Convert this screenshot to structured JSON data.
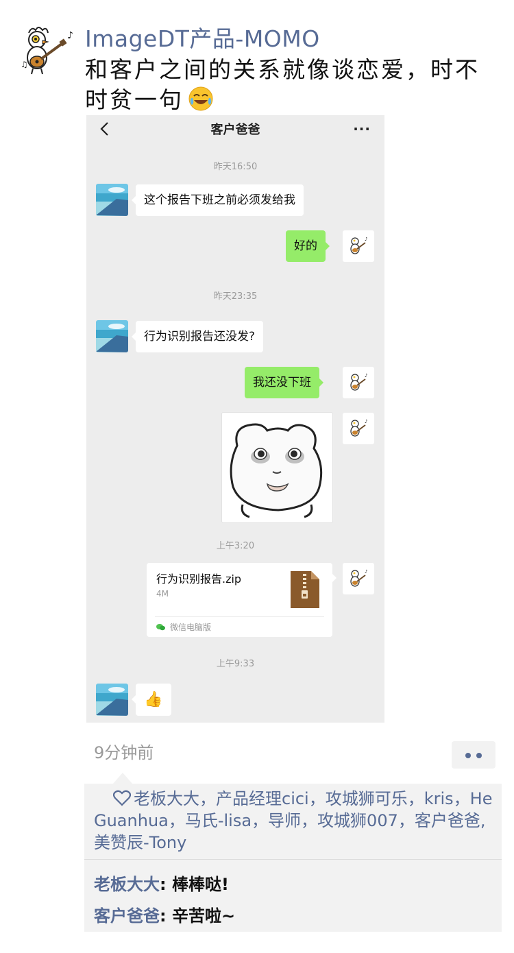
{
  "post": {
    "author_name": "ImageDT产品-MOMO",
    "text": "和客户之间的关系就像谈恋爱，时不时贫一句",
    "time": "9分钟前",
    "likes": "老板大大，产品经理cici，攻城狮可乐，kris，He Guanhua，马氏-lisa，导师，攻城狮007，客户爸爸, 美赞辰-Tony",
    "comments": [
      {
        "author": "老板大大",
        "sep": ": ",
        "text": "棒棒哒!"
      },
      {
        "author": "客户爸爸",
        "sep": ": ",
        "text": "辛苦啦~"
      }
    ]
  },
  "chat": {
    "title": "客户爸爸",
    "more": "···",
    "times": [
      "昨天16:50",
      "昨天23:35",
      "上午3:20",
      "上午9:33"
    ],
    "messages": [
      {
        "from": "left",
        "text": "这个报告下班之前必须发给我"
      },
      {
        "from": "right",
        "text": "好的"
      },
      {
        "from": "left",
        "text": "行为识别报告还没发?"
      },
      {
        "from": "right",
        "text": "我还没下班"
      }
    ],
    "file": {
      "name": "行为识别报告.zip",
      "size": "4M",
      "source": "微信电脑版"
    },
    "thumb_emoji": "👍"
  },
  "colors": {
    "link_blue": "#576b95",
    "chat_bg": "#ededed",
    "bubble_green": "#95ec69",
    "footer_bg": "#f2f2f2"
  },
  "icons": [
    "rooster-guitar-icon",
    "laughing-crying-emoji-icon",
    "back-chevron-icon",
    "zip-file-icon",
    "wechat-pc-icon",
    "heart-icon",
    "more-dots-icon"
  ]
}
